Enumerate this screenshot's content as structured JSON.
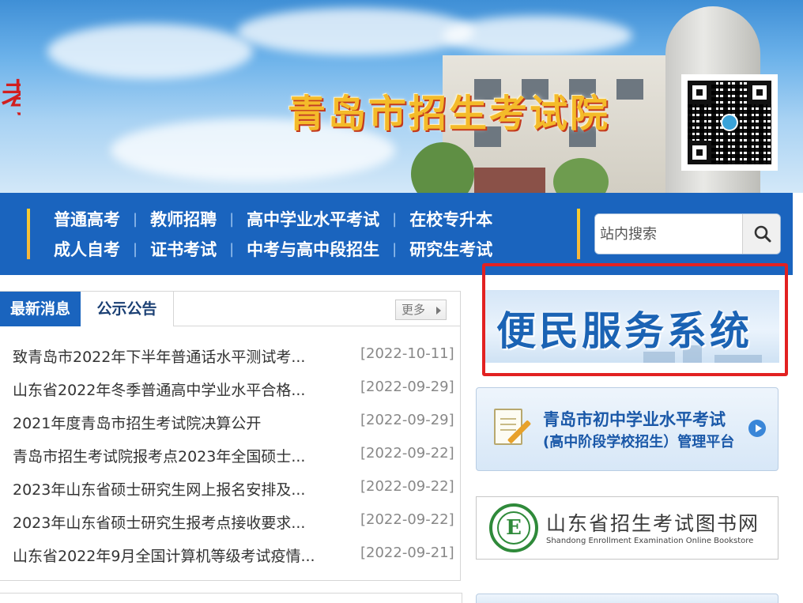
{
  "header": {
    "site_title": "青岛市招生考试院",
    "logo_glyph": "考",
    "qr_code": "qr-code-icon"
  },
  "nav": {
    "row1": [
      "普通高考",
      "教师招聘",
      "高中学业水平考试",
      "在校专升本"
    ],
    "row2": [
      "成人自考",
      "证书考试",
      "中考与高中段招生",
      "研究生考试"
    ],
    "separator": "|"
  },
  "search": {
    "placeholder": "站内搜索",
    "button_icon": "search-icon"
  },
  "news": {
    "tabs": [
      {
        "label": "最新消息",
        "active": true
      },
      {
        "label": "公示公告",
        "active": false
      }
    ],
    "more_label": "更多",
    "items": [
      {
        "title": "致青岛市2022年下半年普通话水平测试考...",
        "date": "[2022-10-11]"
      },
      {
        "title": "山东省2022年冬季普通高中学业水平合格...",
        "date": "[2022-09-29]"
      },
      {
        "title": "2021年度青岛市招生考试院决算公开",
        "date": "[2022-09-29]"
      },
      {
        "title": "青岛市招生考试院报考点2023年全国硕士...",
        "date": "[2022-09-22]"
      },
      {
        "title": "2023年山东省硕士研究生网上报名安排及...",
        "date": "[2022-09-22]"
      },
      {
        "title": "2023年山东省硕士研究生报考点接收要求...",
        "date": "[2022-09-22]"
      },
      {
        "title": "山东省2022年9月全国计算机等级考试疫情...",
        "date": "[2022-09-21]"
      }
    ]
  },
  "sidebar": {
    "service_banner": "便民服务系统",
    "platform": {
      "line1": "青岛市初中学业水平考试",
      "line2": "(高中阶段学校招生）管理平台"
    },
    "bookstore": {
      "name_cn": "山东省招生考试图书网",
      "name_en": "Shandong Enrollment Examination Online Bookstore",
      "logo_letter": "E"
    },
    "highlight_color": "#e22121"
  },
  "colors": {
    "nav_blue": "#1a64be",
    "accent_yellow": "#f7cd2f",
    "title_gold": "#f4bb2a"
  }
}
